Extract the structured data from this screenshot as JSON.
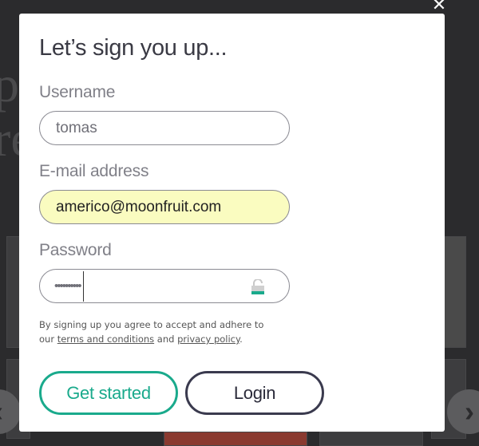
{
  "modal": {
    "title": "Let’s sign you up...",
    "close_icon": "close-icon"
  },
  "form": {
    "username": {
      "label": "Username",
      "value": "tomas"
    },
    "email": {
      "label": "E-mail address",
      "value": "americo@moonfruit.com"
    },
    "password": {
      "label": "Password",
      "masked_value": "••••••••••",
      "icon": "lock-icon"
    }
  },
  "terms": {
    "line1": "By signing up you agree to accept and adhere to",
    "prefix": "our",
    "terms_link": "terms and conditions",
    "and": "and",
    "privacy_link": "privacy policy",
    "suffix": "."
  },
  "buttons": {
    "get_started": "Get started",
    "login": "Login"
  },
  "colors": {
    "accent": "#1aaa8c",
    "secondary_border": "#3a3a4e",
    "autofill": "#fafcc0"
  }
}
